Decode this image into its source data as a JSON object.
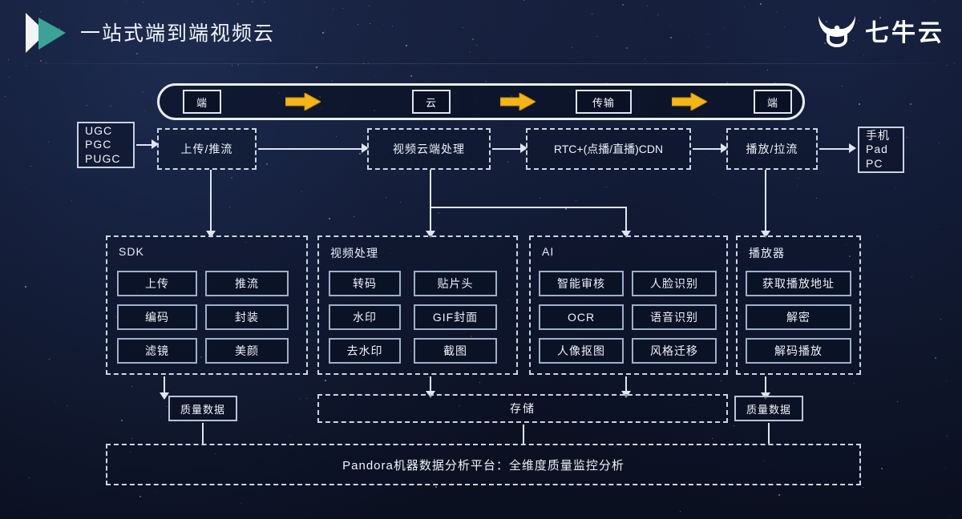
{
  "header": {
    "title": "一站式端到端视频云",
    "brand_name": "七牛云",
    "logo_icon": "play-triangle-icon",
    "brand_icon": "bull-head-icon"
  },
  "pipeline": {
    "nodes": [
      "端",
      "云",
      "传输",
      "端"
    ],
    "arrow_icon": "arrow-right-icon",
    "arrow_color": "#f5b417"
  },
  "flow": {
    "source": {
      "lines": [
        "UGC",
        "PGC",
        "PUGC"
      ]
    },
    "stages": [
      {
        "label": "上传/推流"
      },
      {
        "label": "视频云端处理"
      },
      {
        "label": "RTC+(点播/直播)CDN"
      },
      {
        "label": "播放/拉流"
      }
    ],
    "devices": {
      "lines": [
        "手机",
        "Pad",
        "PC"
      ]
    }
  },
  "groups": [
    {
      "title": "SDK",
      "items": [
        "上传",
        "推流",
        "编码",
        "封装",
        "滤镜",
        "美颜"
      ]
    },
    {
      "title": "视频处理",
      "items": [
        "转码",
        "贴片头",
        "水印",
        "GIF封面",
        "去水印",
        "截图"
      ]
    },
    {
      "title": "AI",
      "items": [
        "智能审核",
        "人脸识别",
        "OCR",
        "语音识别",
        "人像抠图",
        "风格迁移"
      ]
    },
    {
      "title": "播放器",
      "items": [
        "获取播放地址",
        "解密",
        "解码播放"
      ]
    }
  ],
  "footer": {
    "quality_left": "质量数据",
    "storage": "存储",
    "quality_right": "质量数据",
    "platform": "Pandora机器数据分析平台：全维度质量监控分析"
  },
  "colors": {
    "background": "#0b1020",
    "line": "#dfe6f2",
    "accent": "#f5b417",
    "logo_teal": "#3aa396"
  }
}
